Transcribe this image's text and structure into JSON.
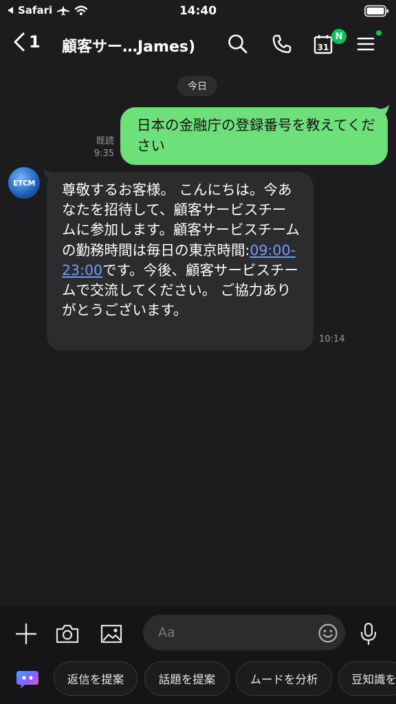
{
  "status": {
    "back_app": "Safari",
    "time": "14:40"
  },
  "header": {
    "back_count": "1",
    "title": "顧客サー…James)",
    "calendar_day": "31",
    "calendar_badge": "N"
  },
  "chat": {
    "date_label": "今日",
    "outgoing": {
      "text": "日本の金融庁の登録番号を教えてください",
      "read_label": "既読",
      "time": "9:35"
    },
    "incoming": {
      "avatar_text": "ETCM",
      "text_before_link": "尊敬するお客様。 こんにちは。今あなたを招待して、顧客サービスチームに参加します。顧客サービスチームの勤務時間は毎日の東京時間:",
      "link_text": "09:00-23:00",
      "text_after_link": "です。今後、顧客サービスチームで交流してください。 ご協力ありがとうございます。",
      "time": "10:14"
    }
  },
  "input": {
    "placeholder": "Aa"
  },
  "suggestions": [
    "返信を提案",
    "話題を提案",
    "ムードを分析",
    "豆知識を"
  ],
  "colors": {
    "accent_green": "#06c755",
    "outgoing_bubble": "#6ee07a",
    "link": "#6e9bff"
  }
}
